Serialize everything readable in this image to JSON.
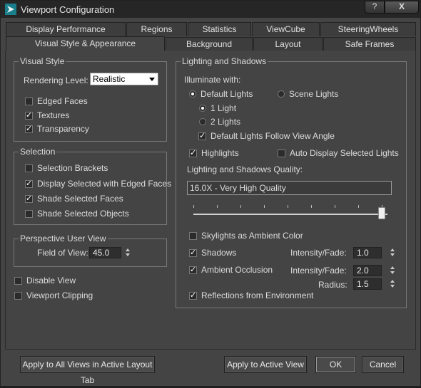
{
  "window": {
    "title": "Viewport Configuration",
    "help_label": "?",
    "close_label": "X"
  },
  "tabs_row1": [
    "Display Performance",
    "Regions",
    "Statistics",
    "ViewCube",
    "SteeringWheels"
  ],
  "tabs_row2": [
    "Visual Style & Appearance",
    "Background",
    "Layout",
    "Safe Frames"
  ],
  "visual_style": {
    "group_label": "Visual Style",
    "rendering_level_label": "Rendering Level:",
    "rendering_level_value": "Realistic",
    "edged_faces": "Edged Faces",
    "textures": "Textures",
    "transparency": "Transparency"
  },
  "selection": {
    "group_label": "Selection",
    "selection_brackets": "Selection Brackets",
    "display_selected_edged": "Display Selected with Edged Faces",
    "shade_selected_faces": "Shade Selected Faces",
    "shade_selected_objects": "Shade Selected Objects"
  },
  "perspective": {
    "group_label": "Perspective User View",
    "fov_label": "Field of View:",
    "fov_value": "45.0"
  },
  "misc": {
    "disable_view": "Disable View",
    "viewport_clipping": "Viewport Clipping"
  },
  "lighting": {
    "group_label": "Lighting and Shadows",
    "illuminate_label": "Illuminate with:",
    "default_lights": "Default Lights",
    "scene_lights": "Scene Lights",
    "one_light": "1 Light",
    "two_lights": "2 Lights",
    "follow_view": "Default Lights Follow View Angle",
    "highlights": "Highlights",
    "auto_display": "Auto Display Selected Lights",
    "quality_label": "Lighting and Shadows Quality:",
    "quality_value": "16.0X - Very High Quality",
    "quality_level": 1.0,
    "skylights": "Skylights as Ambient Color",
    "shadows": "Shadows",
    "shadows_intensity_label": "Intensity/Fade:",
    "shadows_intensity_value": "1.0",
    "ambient_occlusion": "Ambient Occlusion",
    "ao_intensity_label": "Intensity/Fade:",
    "ao_intensity_value": "2.0",
    "radius_label": "Radius:",
    "radius_value": "1.5",
    "reflections": "Reflections from Environment"
  },
  "buttons": {
    "apply_all": "Apply to All Views in Active Layout Tab",
    "apply_active": "Apply to Active View",
    "ok": "OK",
    "cancel": "Cancel"
  }
}
